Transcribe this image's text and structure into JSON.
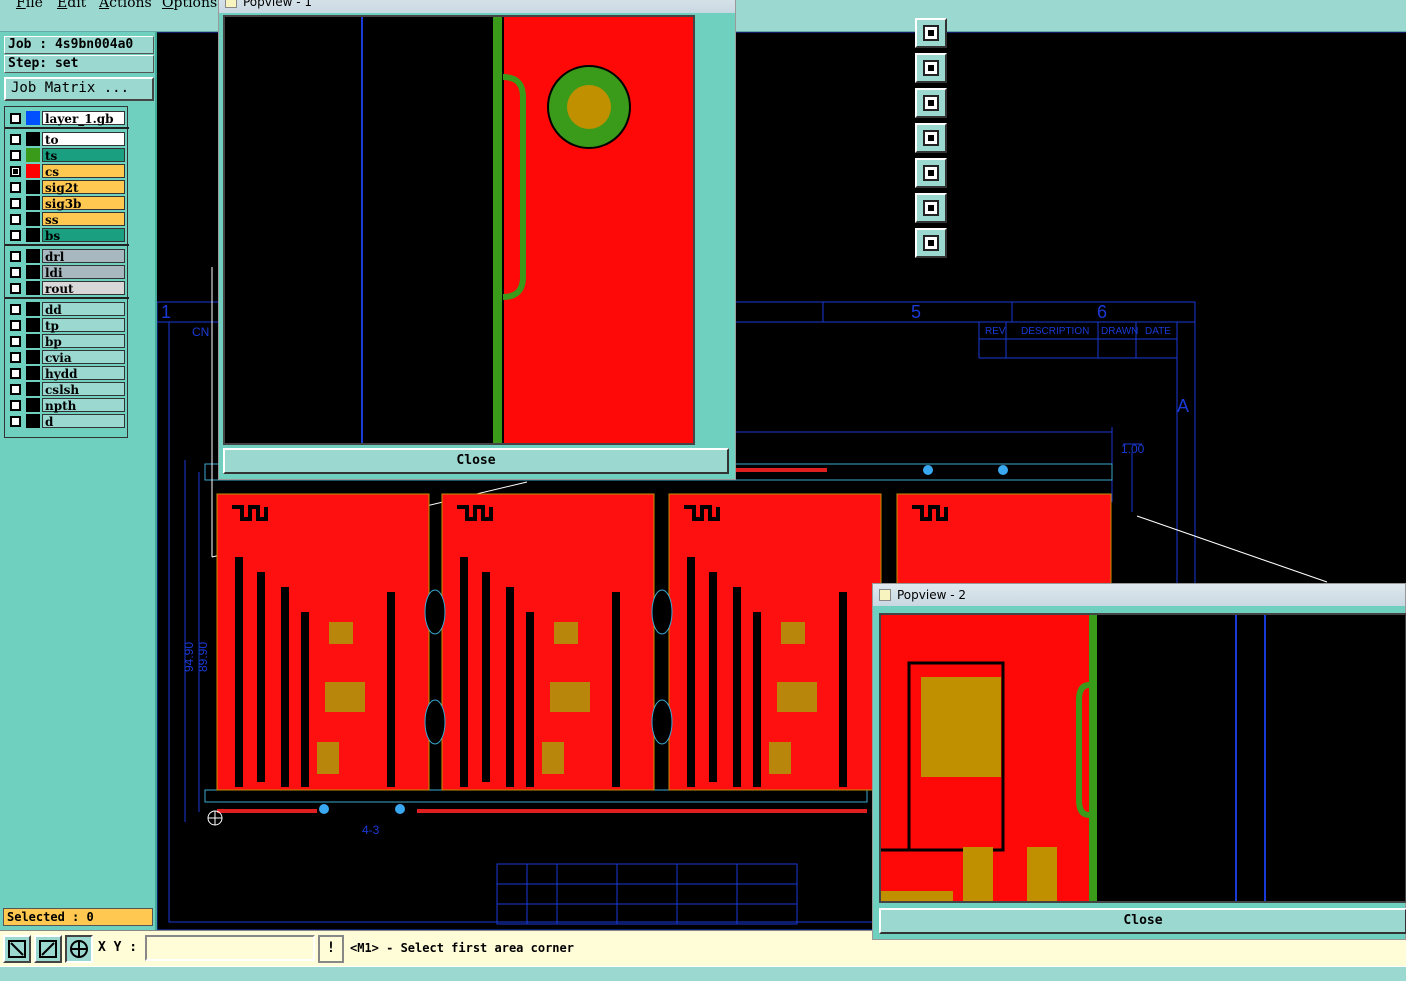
{
  "menu": [
    "File",
    "Edit",
    "Actions",
    "Options"
  ],
  "job": {
    "label": "Job : 4s9bn004a0",
    "step": "Step: set",
    "matrix_button": "Job Matrix ..."
  },
  "layers": [
    {
      "name": "layer_1.gb",
      "color": "#0050ff",
      "bg": "#ffffff",
      "checked": false
    },
    {
      "name": "to",
      "color": "#000000",
      "bg": "#ffffff",
      "checked": false
    },
    {
      "name": "ts",
      "color": "#3a9a1a",
      "bg": "#1aa080",
      "checked": false
    },
    {
      "name": "cs",
      "color": "#ff0000",
      "bg": "#ffc850",
      "checked": true
    },
    {
      "name": "sig2t",
      "color": "#000000",
      "bg": "#ffc850",
      "checked": false
    },
    {
      "name": "sig3b",
      "color": "#000000",
      "bg": "#ffc850",
      "checked": false
    },
    {
      "name": "ss",
      "color": "#000000",
      "bg": "#ffc850",
      "checked": false
    },
    {
      "name": "bs",
      "color": "#000000",
      "bg": "#1aa080",
      "checked": false
    },
    {
      "name": "drl",
      "color": "#000000",
      "bg": "#a8b8c0",
      "checked": false
    },
    {
      "name": "ldi",
      "color": "#000000",
      "bg": "#a8b8c0",
      "checked": false
    },
    {
      "name": "rout",
      "color": "#000000",
      "bg": "#d8d8d8",
      "checked": false
    },
    {
      "name": "dd",
      "color": "#000000",
      "bg": "#9bd8d0",
      "checked": false
    },
    {
      "name": "tp",
      "color": "#000000",
      "bg": "#9bd8d0",
      "checked": false
    },
    {
      "name": "bp",
      "color": "#000000",
      "bg": "#9bd8d0",
      "checked": false
    },
    {
      "name": "cvia",
      "color": "#000000",
      "bg": "#9bd8d0",
      "checked": false
    },
    {
      "name": "hydd",
      "color": "#000000",
      "bg": "#9bd8d0",
      "checked": false
    },
    {
      "name": "cslsh",
      "color": "#000000",
      "bg": "#9bd8d0",
      "checked": false
    },
    {
      "name": "npth",
      "color": "#000000",
      "bg": "#9bd8d0",
      "checked": false
    },
    {
      "name": "d",
      "color": "#000000",
      "bg": "#9bd8d0",
      "checked": false
    }
  ],
  "selected": "Selected : 0",
  "status": {
    "xy_label": "X Y :",
    "xy_value": "",
    "msg_icon": "!",
    "prompt": "<M1> - Select first area corner"
  },
  "drawing": {
    "title_block": {
      "rev": "REV",
      "description": "DESCRIPTION",
      "drawn": "DRAWN",
      "date": "DATE"
    },
    "zone_labels": [
      "1",
      "5",
      "6",
      "A"
    ],
    "dims": [
      "94.90",
      "89.90",
      "1.00",
      "4-3"
    ],
    "partial_label": "CN"
  },
  "popview1": {
    "title": "Popview - 1",
    "close": "Close"
  },
  "popview2": {
    "title": "Popview - 2",
    "close": "Close"
  }
}
